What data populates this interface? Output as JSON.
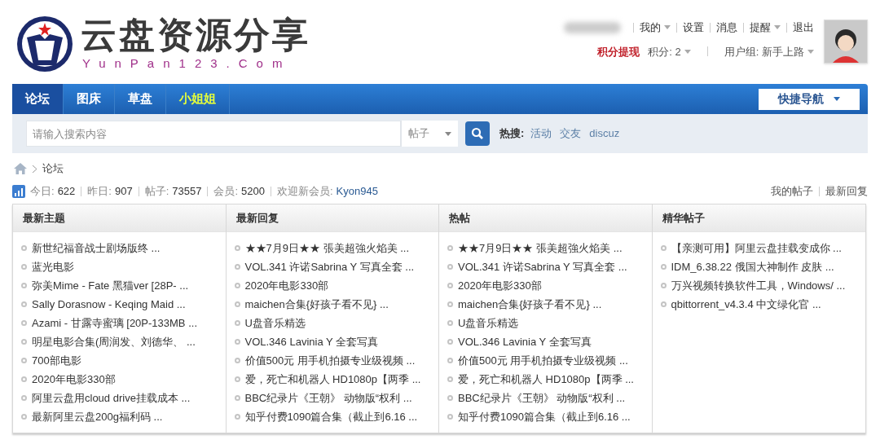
{
  "logo": {
    "title": "云盘资源分享",
    "subtitle": "YunPan123.Com"
  },
  "user_links": [
    {
      "label": "我的",
      "has_menu": true
    },
    {
      "label": "设置",
      "has_menu": false
    },
    {
      "label": "消息",
      "has_menu": false
    },
    {
      "label": "提醒",
      "has_menu": true
    },
    {
      "label": "退出",
      "has_menu": false
    }
  ],
  "user_info": [
    {
      "label": "积分提现",
      "kind": "alert",
      "has_menu": false
    },
    {
      "label": "积分: 2",
      "kind": "plain",
      "has_menu": true
    },
    {
      "label": "用户组: 新手上路",
      "kind": "plain",
      "has_menu": true
    }
  ],
  "nav_tabs": [
    {
      "label": "论坛",
      "selected": true,
      "highlighted": false
    },
    {
      "label": "图床",
      "selected": false,
      "highlighted": false
    },
    {
      "label": "草盘",
      "selected": false,
      "highlighted": false
    },
    {
      "label": "小姐姐",
      "selected": false,
      "highlighted": true
    }
  ],
  "quick_nav": "快捷导航",
  "search": {
    "placeholder": "请输入搜索内容",
    "scope": "帖子",
    "hot_label": "热搜:",
    "hot_terms": [
      "活动",
      "交友",
      "discuz"
    ]
  },
  "breadcrumb": [
    "论坛"
  ],
  "stats": [
    {
      "label": "今日:",
      "value": "622"
    },
    {
      "label": "昨日:",
      "value": "907"
    },
    {
      "label": "帖子:",
      "value": "73557"
    },
    {
      "label": "会员:",
      "value": "5200"
    },
    {
      "label": "欢迎新会员:",
      "value": "Kyon945",
      "kind": "link"
    }
  ],
  "my_links": [
    "我的帖子",
    "最新回复"
  ],
  "columns": [
    {
      "title": "最新主题",
      "items": [
        "新世纪福音战士剧场版终 ...",
        "蓝光电影",
        "弥美Mime - Fate 黑猫ver [28P- ...",
        "Sally Dorasnow - Keqing Maid ...",
        "Azami - 甘露寺蜜璃 [20P-133MB ...",
        "明星电影合集(周润发、刘德华、 ...",
        "700部电影",
        "2020年电影330部",
        "阿里云盘用cloud drive挂载成本 ...",
        "最新阿里云盘200g福利码 ..."
      ]
    },
    {
      "title": "最新回复",
      "items": [
        "★★7月9日★★ 張美超強火焰美 ...",
        "VOL.341 许诺Sabrina Y 写真全套 ...",
        "2020年电影330部",
        "maichen合集{好孩子看不见} ...",
        "U盘音乐精选",
        "VOL.346 Lavinia Y 全套写真",
        "价值500元 用手机拍摄专业级视频 ...",
        "爱，死亡和机器人 HD1080p【两季 ...",
        "BBC纪录片《王朝》 动物版“权利 ...",
        "知乎付费1090篇合集（截止到6.16 ..."
      ]
    },
    {
      "title": "热帖",
      "items": [
        "★★7月9日★★ 張美超強火焰美 ...",
        "VOL.341 许诺Sabrina Y 写真全套 ...",
        "2020年电影330部",
        "maichen合集{好孩子看不见} ...",
        "U盘音乐精选",
        "VOL.346 Lavinia Y 全套写真",
        "价值500元 用手机拍摄专业级视频 ...",
        "爱，死亡和机器人 HD1080p【两季 ...",
        "BBC纪录片《王朝》 动物版“权利 ...",
        "知乎付费1090篇合集（截止到6.16 ..."
      ]
    },
    {
      "title": "精华帖子",
      "items": [
        "【亲测可用】阿里云盘挂载变成你 ...",
        "IDM_6.38.22 俄国大神制作 皮肤 ...",
        "万兴视频转换软件工具，Windows/ ...",
        "qbittorrent_v4.3.4 中文绿化官 ..."
      ]
    }
  ]
}
